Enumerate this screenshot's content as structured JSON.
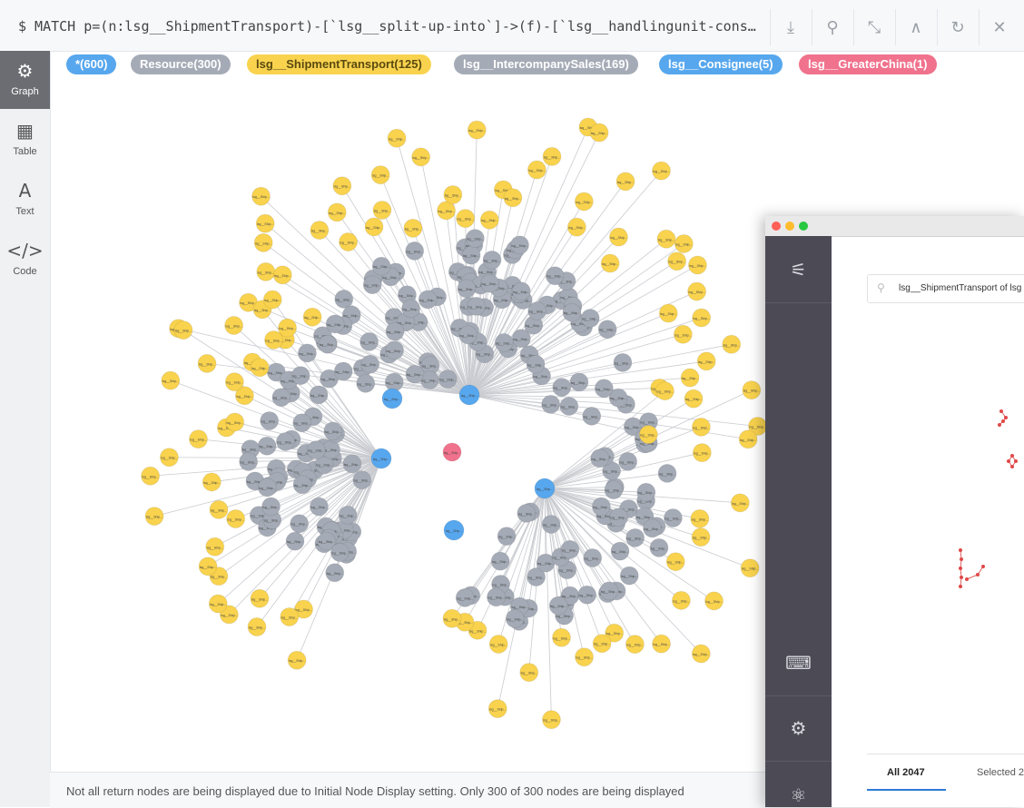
{
  "query": {
    "text": "$ MATCH p=(n:lsg__ShipmentTransport)-[`lsg__split-up-into`]->(f)-[`lsg__handlingunit-cons…"
  },
  "toolbar": {
    "buttons": [
      {
        "name": "download-icon",
        "glyph": "⤓"
      },
      {
        "name": "pin-icon",
        "glyph": "⚲"
      },
      {
        "name": "collapse-icon",
        "glyph": "⤡"
      },
      {
        "name": "chevron-up-icon",
        "glyph": "∧"
      },
      {
        "name": "refresh-icon",
        "glyph": "↻"
      },
      {
        "name": "close-icon",
        "glyph": "✕"
      }
    ]
  },
  "nav": {
    "items": [
      {
        "label": "Graph",
        "icon": "graph-icon",
        "glyph": "⚙",
        "active": true
      },
      {
        "label": "Table",
        "icon": "table-icon",
        "glyph": "▦",
        "active": false
      },
      {
        "label": "Text",
        "icon": "text-icon",
        "glyph": "A",
        "active": false
      },
      {
        "label": "Code",
        "icon": "code-icon",
        "glyph": "</>",
        "active": false
      }
    ]
  },
  "tags": [
    {
      "label": "*(600)",
      "color": "#57a7ee",
      "text": "#ffffff"
    },
    {
      "label": "Resource(300)",
      "color": "#a5abb6",
      "text": "#ffffff"
    },
    {
      "label": "lsg__ShipmentTransport(125)",
      "color": "#f9d34e",
      "text": "#5a4a10"
    },
    {
      "label": "lsg__IntercompanySales(169)",
      "color": "#a5abb6",
      "text": "#ffffff"
    },
    {
      "label": "lsg__Consignee(5)",
      "color": "#57a7ee",
      "text": "#ffffff"
    },
    {
      "label": "lsg__GreaterChina(1)",
      "color": "#f0728d",
      "text": "#ffffff"
    }
  ],
  "status": {
    "text": "Not all return nodes are being displayed due to Initial Node Display setting. Only 300 of 300 nodes are being displayed"
  },
  "graph": {
    "node_colors": {
      "transport": "#f9d34e",
      "sales": "#a5abb6",
      "consignee": "#57a7ee",
      "region": "#f0728d"
    },
    "node_label": "lsg__Ship..."
  },
  "overlay": {
    "search_value": "lsg__ShipmentTransport of lsg",
    "tabs": [
      {
        "label": "All 2047"
      },
      {
        "label": "Selected 2"
      }
    ],
    "side_icons": [
      "sliders-icon",
      "terminal-icon",
      "settings-icon",
      "brain-icon"
    ],
    "traffic_lights": [
      "#fe5f57",
      "#febc2e",
      "#28c840"
    ]
  }
}
